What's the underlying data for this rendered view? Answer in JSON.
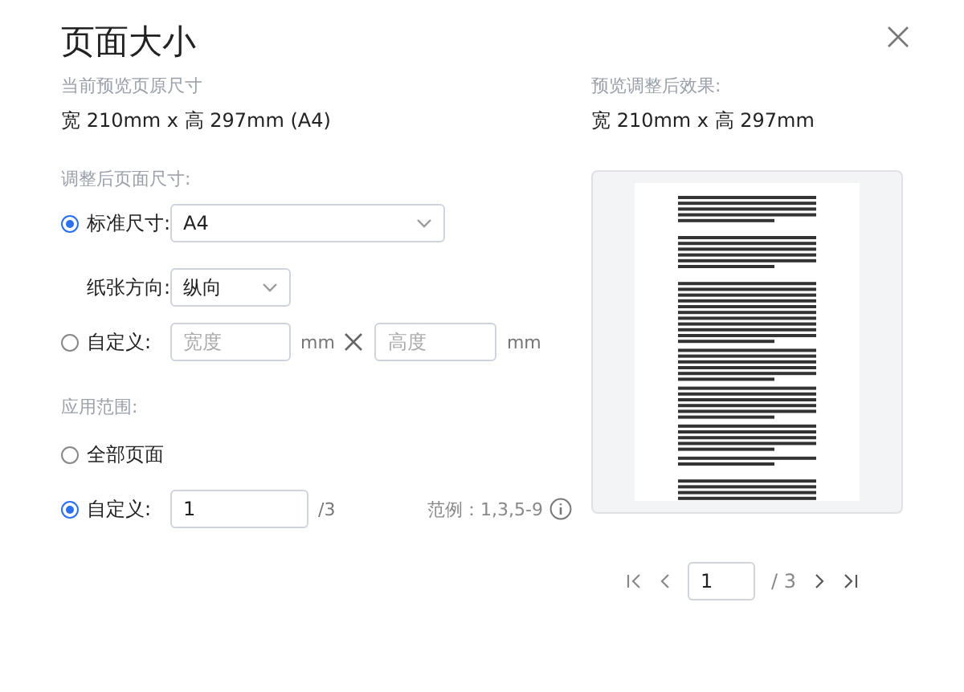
{
  "dialog": {
    "title": "页面大小"
  },
  "current": {
    "label": "当前预览页原尺寸",
    "size": "宽 210mm x 高 297mm (A4)"
  },
  "adjusted": {
    "label": "调整后页面尺寸:",
    "options": [
      {
        "kind": "standard",
        "label": "标准尺寸:",
        "selected": true,
        "value": "A4",
        "orientation_label": "纸张方向:",
        "orientation_value": "纵向"
      },
      {
        "kind": "custom",
        "label": "自定义:",
        "selected": false,
        "width_placeholder": "宽度",
        "width_unit": "mm",
        "height_placeholder": "高度",
        "height_unit": "mm"
      }
    ]
  },
  "range": {
    "label": "应用范围:",
    "options": [
      {
        "kind": "all",
        "label": "全部页面",
        "selected": false
      },
      {
        "kind": "custom",
        "label": "自定义:",
        "selected": true,
        "value": "1",
        "total": "/3",
        "hint": "范例：1,3,5-9"
      }
    ]
  },
  "preview": {
    "label": "预览调整后效果:",
    "size": "宽 210mm x 高 297mm"
  },
  "pagination": {
    "page": "1",
    "total": "/ 3"
  }
}
